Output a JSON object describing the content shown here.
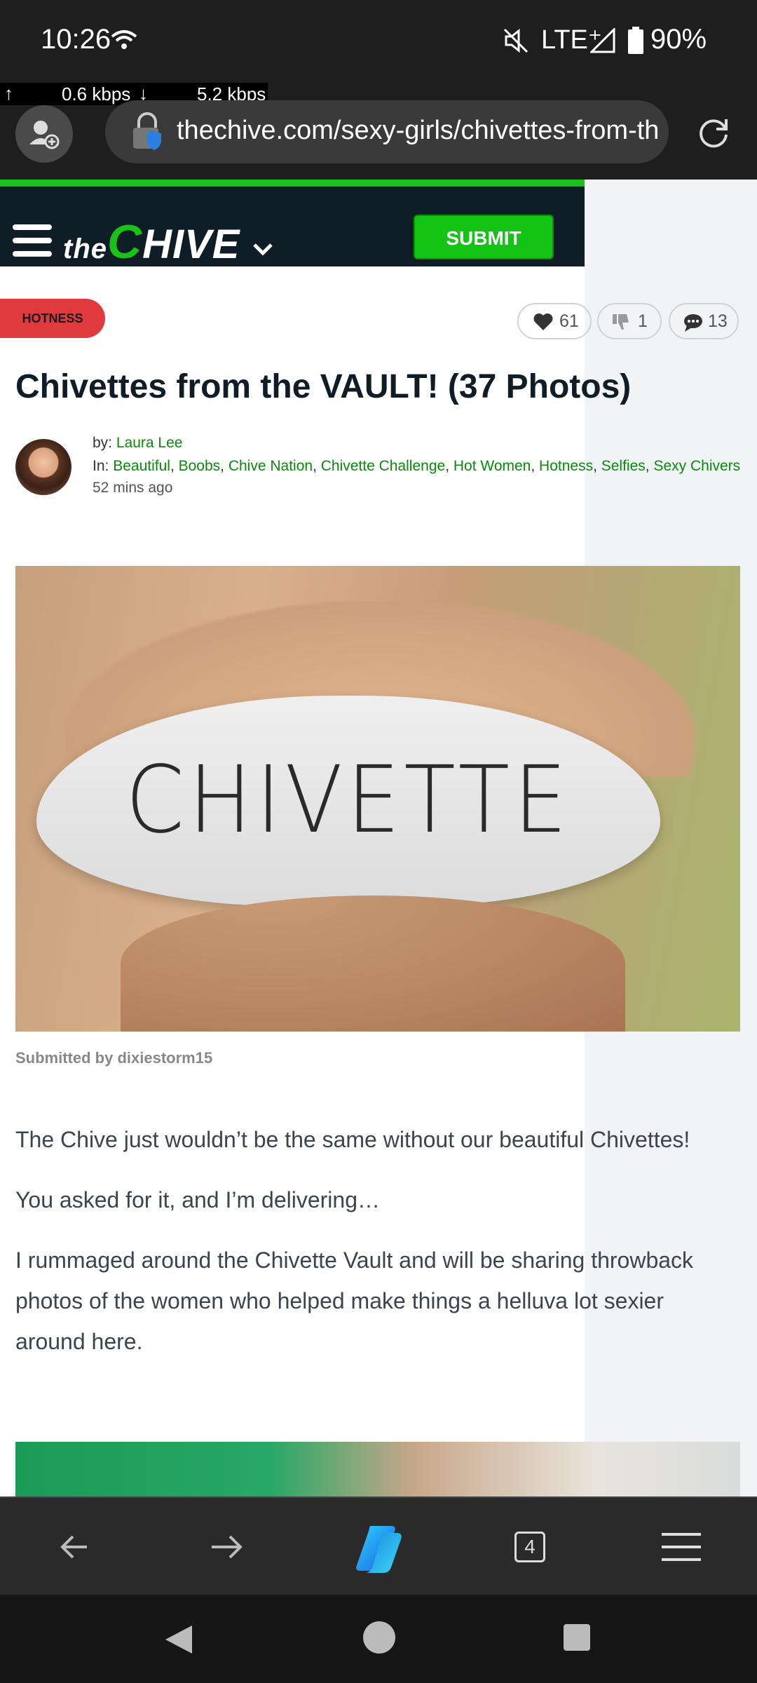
{
  "status_bar": {
    "time": "10:26",
    "network": "LTE⁺",
    "battery": "90%"
  },
  "net_speed": {
    "up": "0.6 kbps",
    "down": "5.2 kbps"
  },
  "browser": {
    "url": "thechive.com/sexy-girls/chivettes-from-th",
    "tab_count": "4"
  },
  "site": {
    "logo_the": "the",
    "logo_c": "C",
    "logo_rest": "HIVE",
    "submit_label": "SUBMIT"
  },
  "article": {
    "category": "HOTNESS",
    "likes": "61",
    "dislikes": "1",
    "comments": "13",
    "title": "Chivettes from the VAULT! (37 Photos)",
    "by_prefix": "by:",
    "author": "Laura Lee",
    "in_prefix": "In:",
    "categories": [
      "Beautiful",
      "Boobs",
      "Chive Nation",
      "Chivette Challenge",
      "Hot Women",
      "Hotness",
      "Selfies",
      "Sexy Chivers"
    ],
    "time_ago": "52 mins ago",
    "photo1_text": "CHIVETTE",
    "photo_credit": "Submitted by dixiestorm15",
    "paragraphs": [
      "The Chive just wouldn’t be the same without our beautiful Chivettes!",
      "You asked for it, and I’m delivering…",
      "I rummaged around the Chivette Vault and will be sharing throwback photos of the women who helped make things a helluva lot sexier around here."
    ]
  },
  "colors": {
    "brand_green": "#19c219",
    "header_bg": "#0e1d26",
    "badge_red": "#e03a3e"
  }
}
